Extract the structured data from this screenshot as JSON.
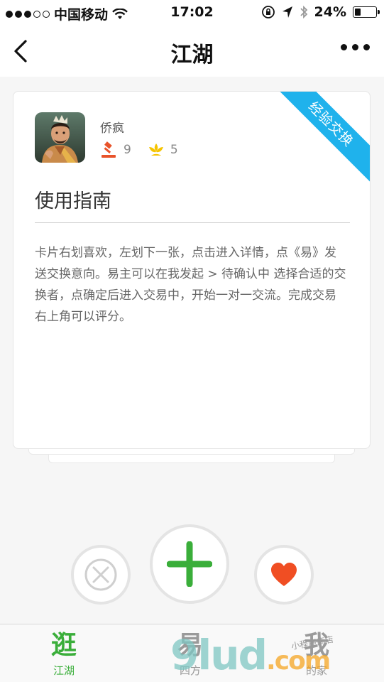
{
  "status_bar": {
    "carrier": "中国移动",
    "time": "17:02",
    "battery": "24%",
    "battery_level": 0.24
  },
  "nav": {
    "title": "江湖"
  },
  "card": {
    "ribbon": "经验交换",
    "author": "侨疯",
    "stats": {
      "bids": "9",
      "likes": "5"
    },
    "title": "使用指南",
    "body": "卡片右划喜欢，左划下一张，点击进入详情，点《易》发送交换意向。易主可以在我发起 > 待确认中 选择合适的交换者，点确定后进入交易中，开始一对一交流。完成交易右上角可以评分。"
  },
  "tabs": [
    {
      "glyph": "逛",
      "label": "江湖"
    },
    {
      "glyph": "易",
      "label": "四方"
    },
    {
      "glyph": "我",
      "label": "的家"
    }
  ],
  "watermark": {
    "text": "9lud",
    "suffix": ".com",
    "sub": "小程序商店"
  },
  "colors": {
    "accent_green": "#3aae3a",
    "ribbon_blue": "#1fb2ec",
    "heart_red": "#f04e23",
    "gavel_red": "#e8532a",
    "flower_yellow": "#f5c400"
  }
}
